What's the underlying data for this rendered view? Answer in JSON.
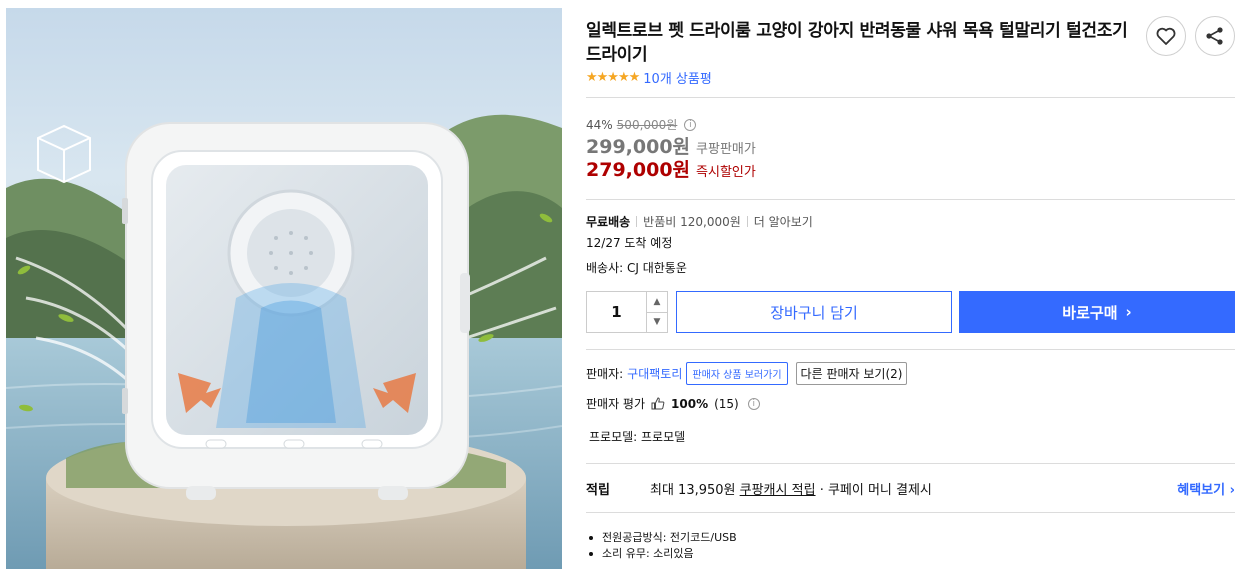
{
  "product": {
    "title": "일렉트로브 펫 드라이룸 고양이 강아지 반려동물 샤워 목욕 털말리기 털건조기 드라이기",
    "stars": "★★★★★",
    "review_count": "10개 상품평",
    "rating_fraction": 1.0
  },
  "actions": {
    "wishlist_icon": "heart-icon",
    "share_icon": "share-icon"
  },
  "price": {
    "discount_rate": "44%",
    "original": "500,000원",
    "info_glyph": "i",
    "coupang_price": "299,000원",
    "coupang_label": "쿠팡판매가",
    "instant_price": "279,000원",
    "instant_label": "즉시할인가"
  },
  "shipping": {
    "free_label": "무료배송",
    "return_fee": "반품비 120,000원",
    "more": "더 알아보기",
    "eta": "12/27 도착 예정",
    "carrier": "배송사: CJ 대한통운"
  },
  "purchase": {
    "quantity": "1",
    "up_glyph": "▲",
    "down_glyph": "▼",
    "cart_label": "장바구니 담기",
    "buy_label": "바로구매",
    "buy_arrow": "›"
  },
  "seller": {
    "label": "판매자:",
    "name": "구대팩토리",
    "view_products": "판매자 상품 보러가기",
    "other_sellers": "다른 판매자 보기(2)",
    "rating_label": "판매자 평가",
    "rating_percent": "100%",
    "rating_count": "(15)",
    "model": "프로모델: 프로모델"
  },
  "benefit": {
    "label": "적립",
    "max_prefix": "최대 13,950원",
    "cash_link": "쿠팡캐시 적립",
    "suffix": "· 쿠페이 머니 결제시",
    "more": "혜택보기 ›"
  },
  "specs": [
    "전원공급방식: 전기코드/USB",
    "소리 유무: 소리있음"
  ],
  "colors": {
    "accent": "#346aff",
    "price_red": "#ae0000",
    "star": "#f5a623"
  }
}
